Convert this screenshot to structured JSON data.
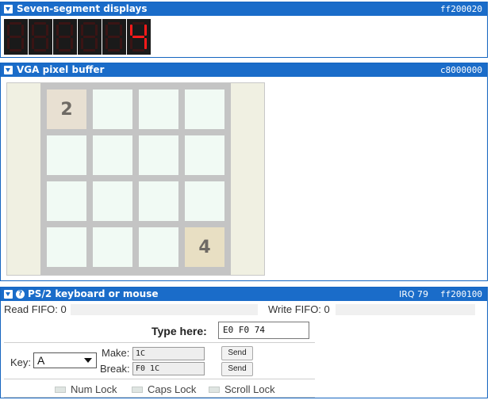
{
  "seven_segment": {
    "title": "Seven-segment displays",
    "address": "ff200020",
    "digits": [
      {
        "on": []
      },
      {
        "on": []
      },
      {
        "on": []
      },
      {
        "on": []
      },
      {
        "on": []
      },
      {
        "value": "4",
        "on": [
          "b",
          "c",
          "f",
          "g"
        ]
      }
    ]
  },
  "vga": {
    "title": "VGA pixel buffer",
    "address": "c8000000",
    "grid": [
      [
        "2",
        "",
        "",
        ""
      ],
      [
        "",
        "",
        "",
        ""
      ],
      [
        "",
        "",
        "",
        ""
      ],
      [
        "",
        "",
        "",
        "4"
      ]
    ]
  },
  "ps2": {
    "title": "PS/2 keyboard or mouse",
    "irq": "IRQ 79",
    "address": "ff200100",
    "read_fifo": "Read FIFO: 0",
    "write_fifo": "Write FIFO: 0",
    "type_here_label": "Type here:",
    "type_here_value": "E0 F0 74",
    "key_label": "Key:",
    "key_selected": "A",
    "make_label": "Make:",
    "make_value": "1C",
    "break_label": "Break:",
    "break_value": "F0 1C",
    "send_label": "Send",
    "locks": {
      "num": "Num Lock",
      "caps": "Caps Lock",
      "scroll": "Scroll Lock"
    }
  },
  "colors": {
    "header": "#1a6cc9",
    "segment_on": "#ff1a1a",
    "segment_off": "#3a1414"
  }
}
